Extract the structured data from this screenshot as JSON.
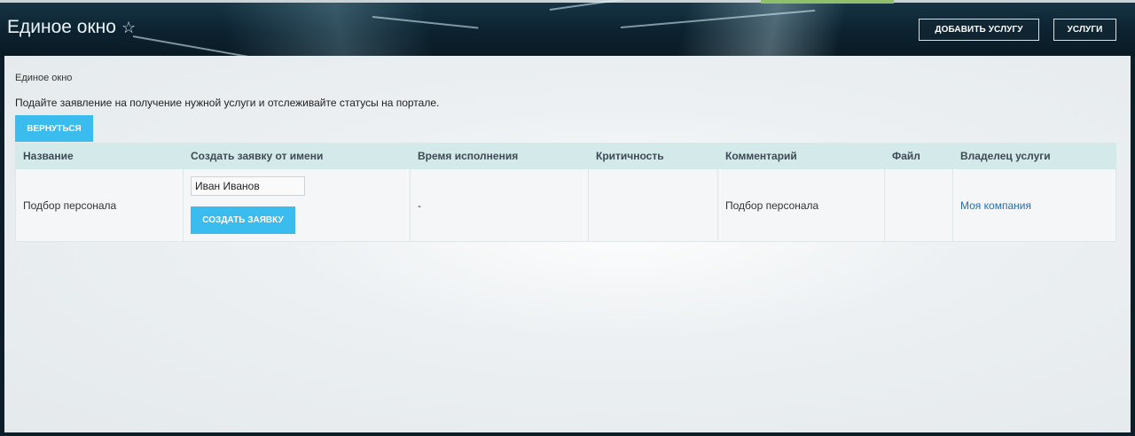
{
  "header": {
    "title": "Единое окно",
    "favorite_icon": "star-outline-icon",
    "add_service_label": "ДОБАВИТЬ УСЛУГУ",
    "services_label": "УСЛУГИ"
  },
  "main": {
    "breadcrumb": "Единое окно",
    "description": "Подайте заявление на получение нужной услуги и отслеживайте статусы на портале.",
    "back_label": "ВЕРНУТЬСЯ",
    "table": {
      "columns": [
        "Название",
        "Создать заявку от имени",
        "Время исполнения",
        "Критичность",
        "Комментарий",
        "Файл",
        "Владелец услуги"
      ],
      "rows": [
        {
          "name": "Подбор персонала",
          "applicant": "Иван Иванов",
          "create_label": "СОЗДАТЬ ЗАЯВКУ",
          "execution_time": "-",
          "criticality": "",
          "comment": "Подбор персонала",
          "file": "",
          "owner": "Моя компания"
        }
      ]
    }
  },
  "colors": {
    "accent": "#3bbcef",
    "table_header": "#d3e9ea",
    "link": "#2a6fad"
  }
}
